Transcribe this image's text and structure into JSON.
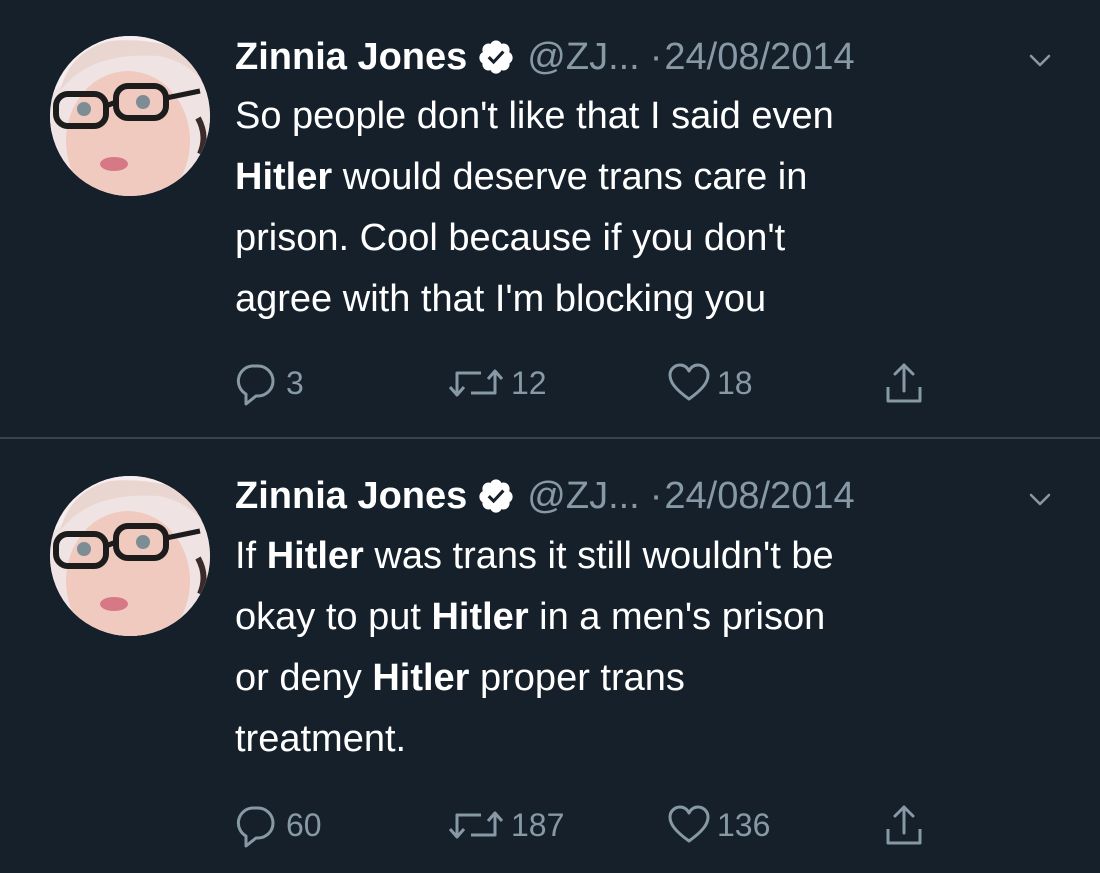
{
  "tweets": [
    {
      "author": {
        "name": "Zinnia Jones",
        "handle": "@ZJ...",
        "separator": "·",
        "date": "24/08/2014"
      },
      "text_lines": [
        [
          {
            "text": "So people don't like that I said even",
            "bold": false
          }
        ],
        [
          {
            "text": "Hitler",
            "bold": true
          },
          {
            "text": " would deserve trans care in",
            "bold": false
          }
        ],
        [
          {
            "text": "prison. Cool because if you don't",
            "bold": false
          }
        ],
        [
          {
            "text": "agree with that I'm blocking you",
            "bold": false
          }
        ]
      ],
      "stats": {
        "replies": "3",
        "retweets": "12",
        "likes": "18"
      }
    },
    {
      "author": {
        "name": "Zinnia Jones",
        "handle": "@ZJ...",
        "separator": "·",
        "date": "24/08/2014"
      },
      "text_lines": [
        [
          {
            "text": "If ",
            "bold": false
          },
          {
            "text": "Hitler",
            "bold": true
          },
          {
            "text": " was trans it still wouldn't be",
            "bold": false
          }
        ],
        [
          {
            "text": "okay to put ",
            "bold": false
          },
          {
            "text": "Hitler",
            "bold": true
          },
          {
            "text": " in a men's prison",
            "bold": false
          }
        ],
        [
          {
            "text": "or deny ",
            "bold": false
          },
          {
            "text": "Hitler",
            "bold": true
          },
          {
            "text": " proper trans",
            "bold": false
          }
        ],
        [
          {
            "text": "treatment.",
            "bold": false
          }
        ]
      ],
      "stats": {
        "replies": "60",
        "retweets": "187",
        "likes": "136"
      }
    }
  ],
  "icons": {
    "verified": "verified-badge-icon",
    "menu": "chevron-down-icon",
    "reply": "reply-icon",
    "retweet": "retweet-icon",
    "like": "heart-icon",
    "share": "share-icon"
  },
  "colors": {
    "background": "#15202b",
    "text_primary": "#ffffff",
    "text_secondary": "#8899a6",
    "divider": "#38444d"
  }
}
